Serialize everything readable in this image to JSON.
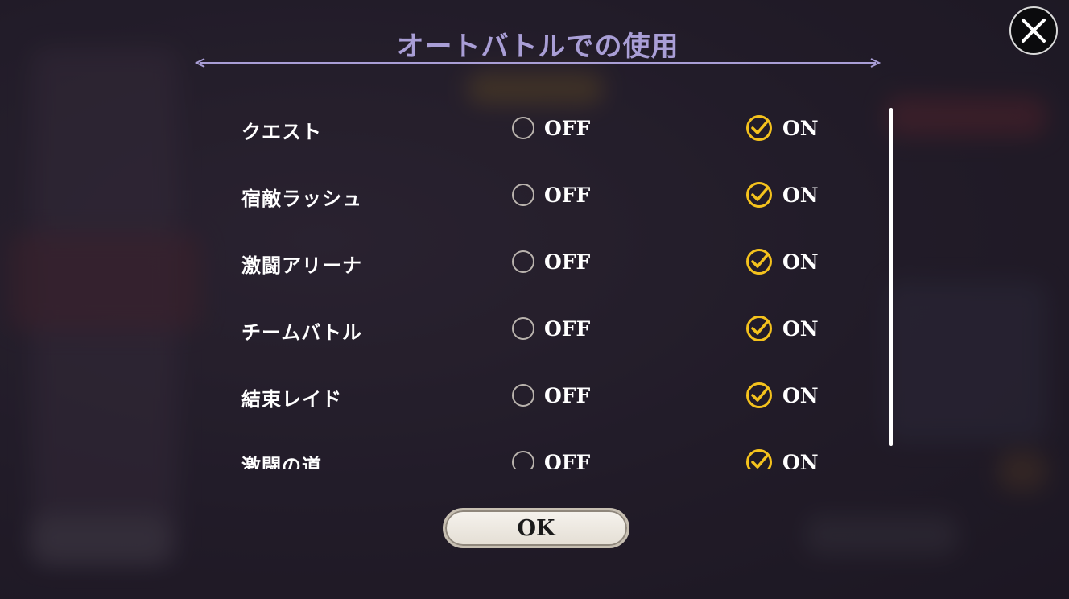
{
  "dialog": {
    "title": "オートバトルでの使用",
    "close_icon": "close-icon",
    "ok_label": "OK"
  },
  "colors": {
    "accent_on": "#f4c21d",
    "title": "#a99ed6",
    "radio_off": "#b9b3ad"
  },
  "settings": [
    {
      "label": "クエスト",
      "off_label": "OFF",
      "on_label": "ON",
      "selected": "ON"
    },
    {
      "label": "宿敵ラッシュ",
      "off_label": "OFF",
      "on_label": "ON",
      "selected": "ON"
    },
    {
      "label": "激闘アリーナ",
      "off_label": "OFF",
      "on_label": "ON",
      "selected": "ON"
    },
    {
      "label": "チームバトル",
      "off_label": "OFF",
      "on_label": "ON",
      "selected": "ON"
    },
    {
      "label": "結束レイド",
      "off_label": "OFF",
      "on_label": "ON",
      "selected": "ON"
    },
    {
      "label": "激闘の道",
      "off_label": "OFF",
      "on_label": "ON",
      "selected": "ON"
    }
  ]
}
